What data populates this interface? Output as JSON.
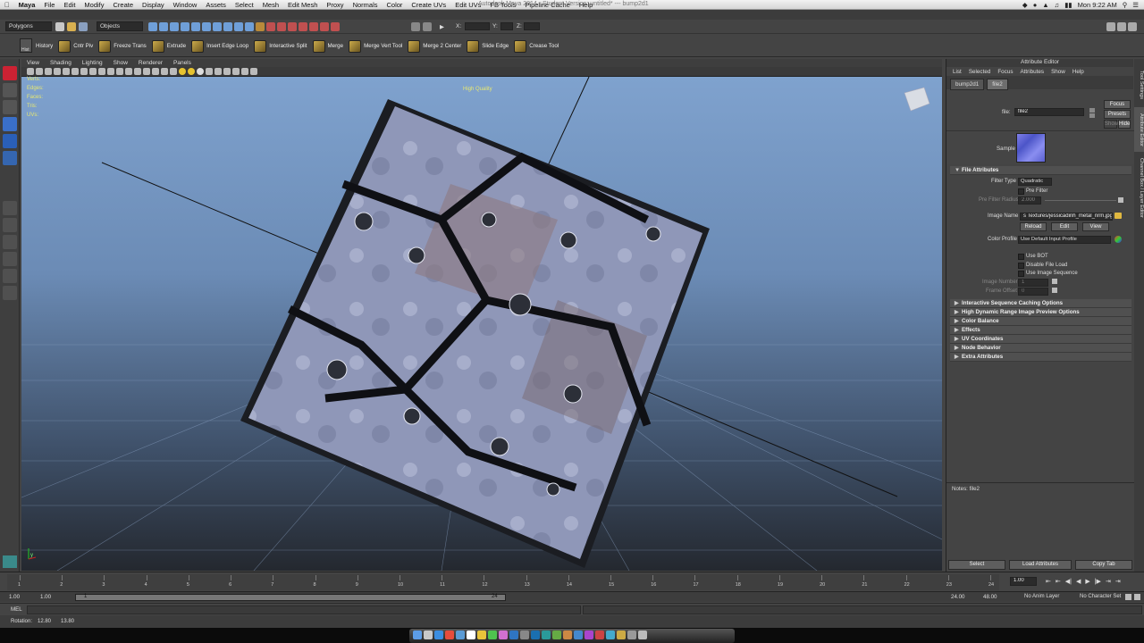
{
  "mac_menubar": {
    "apple": "",
    "items": [
      "Maya",
      "File",
      "Edit",
      "Modify",
      "Create",
      "Display",
      "Window",
      "Assets",
      "Select",
      "Mesh",
      "Edit Mesh",
      "Proxy",
      "Normals",
      "Color",
      "Create UVs",
      "Edit UVs",
      "FB Tools",
      "Pipeline Cache",
      "Help"
    ],
    "window_title": "Autodesk Maya 2014 - Student Version: untitled*   ---   bump2d1",
    "clock": "Mon 9:22 AM"
  },
  "status_line": {
    "menu_set": "Polygons",
    "objects_label": "Objects",
    "x_label": "X:",
    "y_label": "Y:",
    "z_label": "Z:"
  },
  "shelf": {
    "items": [
      "History",
      "Cntr Piv",
      "Freeze Trans",
      "Extrude",
      "Insert Edge Loop",
      "Interactive Split",
      "Merge",
      "Merge Vert Tool",
      "Merge 2 Center",
      "Slide Edge",
      "Crease Tool"
    ],
    "hist_label": "Hist"
  },
  "viewport": {
    "menu": [
      "View",
      "Shading",
      "Lighting",
      "Show",
      "Renderer",
      "Panels"
    ],
    "hud": [
      {
        "label": "Verts:",
        "v1": "",
        "v2": "",
        "v3": ""
      },
      {
        "label": "Edges:",
        "v1": "",
        "v2": "",
        "v3": ""
      },
      {
        "label": "Faces:",
        "v1": "",
        "v2": "",
        "v3": ""
      },
      {
        "label": "Tris:",
        "v1": "",
        "v2": "",
        "v3": ""
      },
      {
        "label": "UVs:",
        "v1": "",
        "v2": "",
        "v3": ""
      }
    ],
    "quality_label": "High Quality",
    "axis_label": "y"
  },
  "attribute_editor": {
    "title": "Attribute Editor",
    "menu": [
      "List",
      "Selected",
      "Focus",
      "Attributes",
      "Show",
      "Help"
    ],
    "tabs": [
      "bump2d1",
      "file2"
    ],
    "active_tab": "file2",
    "node_type_label": "file:",
    "node_name": "file2",
    "focus_btn": "Focus",
    "presets_btn": "Presets",
    "show_btn": "Show",
    "hide_btn": "Hide",
    "sample_label": "Sample",
    "file_attributes_header": "File Attributes",
    "filter_type_label": "Filter Type",
    "filter_type_value": "Quadratic",
    "pre_filter_label": "Pre Filter",
    "pre_filter_radius_label": "Pre Filter Radius",
    "pre_filter_radius_value": "2.000",
    "image_name_label": "Image Name",
    "image_name_value": "s Textures/jessicadinh_metal_nrm.jpg",
    "reload_btn": "Reload",
    "edit_btn": "Edit",
    "view_btn": "View",
    "color_profile_label": "Color Profile",
    "color_profile_value": "Use Default Input Profile",
    "use_bot": "Use BOT",
    "disable_file_load": "Disable File Load",
    "use_image_sequence": "Use Image Sequence",
    "image_number_label": "Image Number",
    "image_number_value": "1",
    "frame_offset_label": "Frame Offset",
    "frame_offset_value": "0",
    "sections": [
      "Interactive Sequence Caching Options",
      "High Dynamic Range Image Preview Options",
      "Color Balance",
      "Effects",
      "UV Coordinates",
      "Node Behavior",
      "Extra Attributes"
    ],
    "notes_label": "Notes:  file2",
    "select_btn": "Select",
    "load_attributes_btn": "Load Attributes",
    "copy_tab_btn": "Copy Tab",
    "side_tabs": [
      "Tool Settings",
      "Attribute Editor",
      "Channel Box / Layer Editor"
    ]
  },
  "time_slider": {
    "ticks": [
      "1",
      "2",
      "3",
      "4",
      "5",
      "6",
      "7",
      "8",
      "9",
      "10",
      "11",
      "12",
      "13",
      "14",
      "15",
      "16",
      "17",
      "18",
      "19",
      "20",
      "21",
      "22",
      "23",
      "24"
    ],
    "current_frame": "1.00"
  },
  "range_slider": {
    "start": "1.00",
    "start2": "1.00",
    "inner_start": "1",
    "inner_end": "24",
    "end1": "24.00",
    "end2": "48.00",
    "anim_layer": "No Anim Layer",
    "char_set": "No Character Set"
  },
  "command_line": {
    "label": "MEL"
  },
  "help_line": {
    "label": "Rotation:",
    "v1": "12.80",
    "v2": "13.80"
  },
  "colors": {
    "viewport_top": "#7fa2ce",
    "viewport_bottom": "#24282f",
    "hud_text": "#e8e870"
  }
}
